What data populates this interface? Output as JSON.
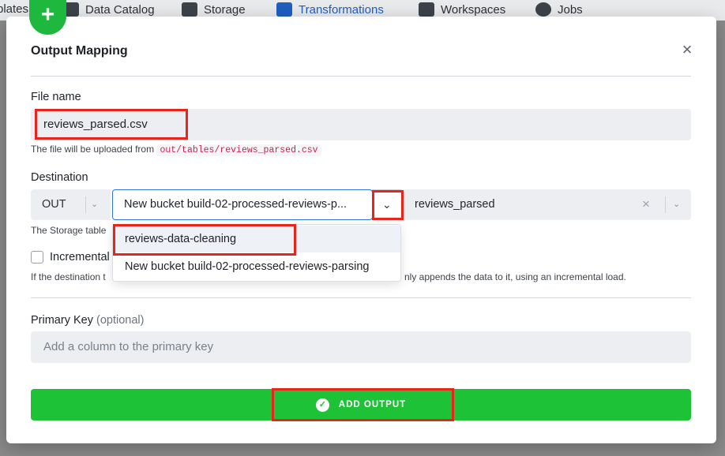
{
  "nav": {
    "items": [
      {
        "label": "plates",
        "icon": "none"
      },
      {
        "label": "Data Catalog",
        "icon": "catalog-icon"
      },
      {
        "label": "Storage",
        "icon": "storage-icon"
      },
      {
        "label": "Transformations",
        "icon": "transformations-icon"
      },
      {
        "label": "Workspaces",
        "icon": "workspaces-icon"
      },
      {
        "label": "Jobs",
        "icon": "jobs-icon"
      }
    ],
    "active": "Transformations"
  },
  "fab": {
    "icon": "plus-icon",
    "symbol": "+"
  },
  "modal": {
    "title": "Output Mapping",
    "close_symbol": "×",
    "file_name": {
      "label": "File name",
      "value": "reviews_parsed.csv",
      "help_prefix": "The file will be uploaded from",
      "help_path": "out/tables/reviews_parsed.csv"
    },
    "destination": {
      "label": "Destination",
      "stage": "OUT",
      "bucket": "New bucket build-02-processed-reviews-p...",
      "table": "reviews_parsed",
      "help_fragment": "The Storage table",
      "options": [
        "reviews-data-cleaning",
        "New bucket build-02-processed-reviews-parsing"
      ]
    },
    "incremental": {
      "label": "Incremental",
      "checked": false,
      "help_prefix": "If the destination t",
      "help_suffix": "nly appends the data to it, using an incremental load."
    },
    "primary_key": {
      "label": "Primary Key",
      "optional": "(optional)",
      "placeholder": "Add a column to the primary key"
    },
    "submit": {
      "label": "ADD OUTPUT",
      "icon": "check-circle-icon"
    }
  },
  "colors": {
    "accent": "#1ec236",
    "highlight": "#e8251d",
    "focus": "#2f74e0"
  }
}
